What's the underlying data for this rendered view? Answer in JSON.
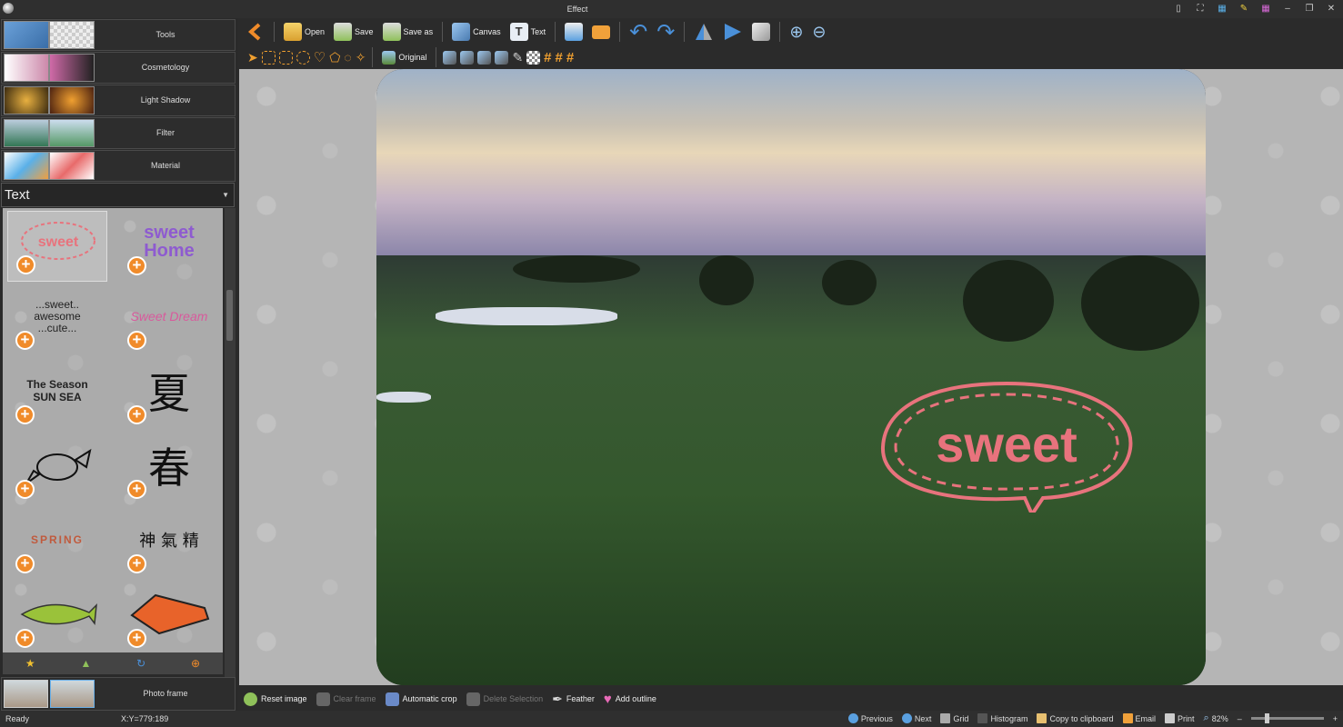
{
  "window": {
    "title": "Effect"
  },
  "sidebar": {
    "categories": [
      {
        "label": "Tools",
        "icon": "tools-thumbnail"
      },
      {
        "label": "Cosmetology",
        "icon": "cosmetology-thumbnail"
      },
      {
        "label": "Light Shadow",
        "icon": "light-shadow-thumbnail"
      },
      {
        "label": "Filter",
        "icon": "filter-thumbnail"
      },
      {
        "label": "Material",
        "icon": "material-thumbnail"
      }
    ],
    "dropdown_value": "Text",
    "gallery_items": [
      {
        "text": "sweet",
        "color": "#e8737d"
      },
      {
        "text": "sweet Home",
        "color": "#8e5bd0"
      },
      {
        "text": "...sweet.. awesome ...cute...",
        "color": "#222"
      },
      {
        "text": "Sweet Dream",
        "color": "#d85a9c"
      },
      {
        "text": "The Season SUN SEA",
        "color": "#222"
      },
      {
        "text": "夏",
        "color": "#111"
      },
      {
        "text": "",
        "color": "#111"
      },
      {
        "text": "春",
        "color": "#111"
      },
      {
        "text": "SPRING",
        "color": "#c05a3d"
      },
      {
        "text": "神 氣 精",
        "color": "#111"
      },
      {
        "text": "",
        "color": "#7fae2a"
      },
      {
        "text": "",
        "color": "#e8632a"
      }
    ],
    "gallery_tools": [
      "star-icon",
      "tree-icon",
      "refresh-icon",
      "add-icon"
    ],
    "photo_frame_label": "Photo frame"
  },
  "toolbar1": [
    {
      "label": "",
      "icon": "back-icon",
      "color": "#f08b2a"
    },
    {
      "label": "Open",
      "icon": "open-folder-icon",
      "color": "#e8b33a"
    },
    {
      "label": "Save",
      "icon": "save-icon",
      "color": "#8fc15a"
    },
    {
      "label": "Save as",
      "icon": "save-as-icon",
      "color": "#8fc15a"
    },
    {
      "label": "Canvas",
      "icon": "canvas-icon",
      "color": "#6aa6d8"
    },
    {
      "label": "Text",
      "icon": "text-icon",
      "color": "#6aa6d8"
    },
    {
      "label": "",
      "icon": "print-icon",
      "color": "#5aa0e0"
    },
    {
      "label": "",
      "icon": "email-icon",
      "color": "#f0a13a"
    },
    {
      "label": "",
      "icon": "undo-icon",
      "color": "#4a90d9"
    },
    {
      "label": "",
      "icon": "redo-icon",
      "color": "#4a90d9"
    },
    {
      "label": "",
      "icon": "flip-horizontal-icon",
      "color": "#4a90d9"
    },
    {
      "label": "",
      "icon": "flip-vertical-icon",
      "color": "#4a90d9"
    },
    {
      "label": "",
      "icon": "rotate-icon",
      "color": "#cccccc"
    },
    {
      "label": "",
      "icon": "zoom-in-icon",
      "color": "#4a90d9"
    },
    {
      "label": "",
      "icon": "zoom-out-icon",
      "color": "#4a90d9"
    }
  ],
  "toolbar2": {
    "original_label": "Original",
    "tools": [
      "pointer-icon",
      "rect-select-icon",
      "rounded-rect-select-icon",
      "ellipse-select-icon",
      "heart-select-icon",
      "polygon-select-icon",
      "lasso-icon",
      "magic-wand-icon"
    ],
    "right_tools": [
      "effect1-icon",
      "effect2-icon",
      "effect3-icon",
      "effect4-icon",
      "brush-icon",
      "checker-icon",
      "grid1-icon",
      "grid2-icon",
      "grid3-icon"
    ]
  },
  "bottombar": [
    {
      "label": "Reset image",
      "icon": "reset-icon",
      "enabled": true
    },
    {
      "label": "Clear frame",
      "icon": "clear-frame-icon",
      "enabled": false
    },
    {
      "label": "Automatic crop",
      "icon": "crop-icon",
      "enabled": true
    },
    {
      "label": "Delete Selection",
      "icon": "delete-selection-icon",
      "enabled": false
    },
    {
      "label": "Feather",
      "icon": "feather-icon",
      "enabled": true
    },
    {
      "label": "Add outline",
      "icon": "heart-outline-icon",
      "enabled": true
    }
  ],
  "status": {
    "ready": "Ready",
    "coords": "X:Y=779:189",
    "buttons": [
      {
        "label": "Previous",
        "icon": "previous-icon"
      },
      {
        "label": "Next",
        "icon": "next-icon"
      },
      {
        "label": "Grid",
        "icon": "grid-icon"
      },
      {
        "label": "Histogram",
        "icon": "histogram-icon"
      },
      {
        "label": "Copy to clipboard",
        "icon": "clipboard-icon"
      },
      {
        "label": "Email",
        "icon": "email-icon"
      },
      {
        "label": "Print",
        "icon": "print-icon"
      }
    ],
    "zoom": "82%",
    "zoom_level": 0.2
  },
  "canvas": {
    "sticker_text": "sweet",
    "sticker_color": "#e8737d"
  }
}
